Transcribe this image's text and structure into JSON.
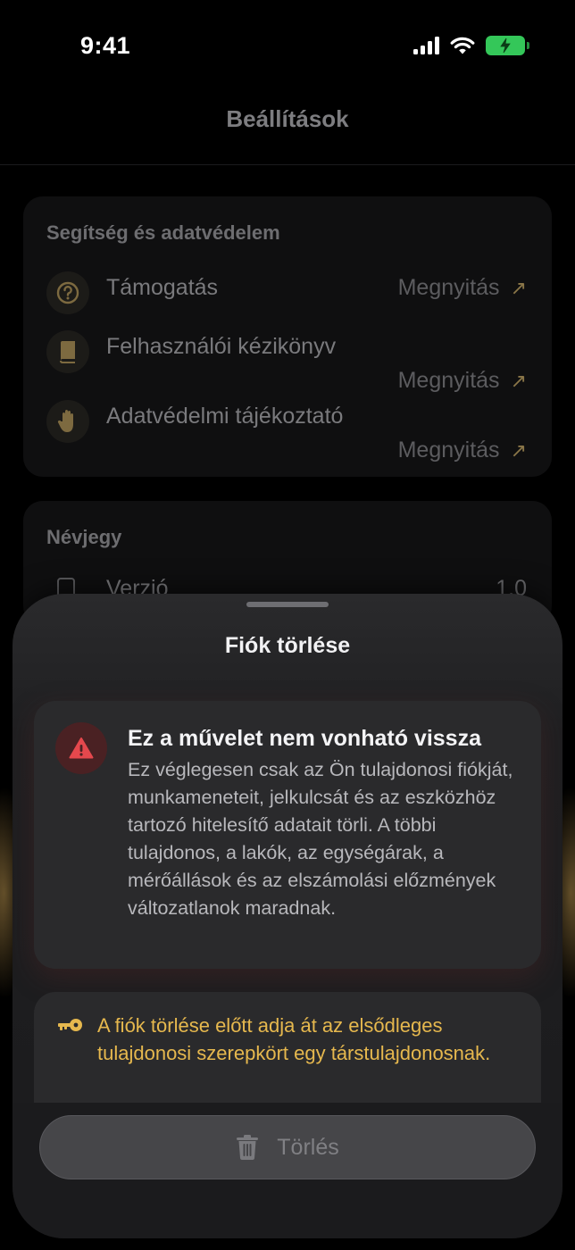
{
  "status_bar": {
    "time": "9:41"
  },
  "nav": {
    "title": "Beállítások"
  },
  "help_section": {
    "heading": "Segítség és adatvédelem",
    "items": [
      {
        "icon": "question-icon",
        "label": "Támogatás",
        "action": "Megnyitás"
      },
      {
        "icon": "book-icon",
        "label": "Felhasználói kézikönyv",
        "action": "Megnyitás"
      },
      {
        "icon": "hand-icon",
        "label": "Adatvédelmi tájékoztató",
        "action": "Megnyitás"
      }
    ]
  },
  "about_section": {
    "heading": "Névjegy",
    "items": [
      {
        "icon": "device-icon",
        "label": "Verzió",
        "value": "1.0"
      }
    ]
  },
  "sheet": {
    "title": "Fiók törlése",
    "warning": {
      "icon": "warning-triangle-icon",
      "title": "Ez a művelet nem vonható vissza",
      "body": "Ez véglegesen csak az Ön tulajdonosi fiókját, munkameneteit, jelkulcsát és az eszközhöz tartozó hitelesítő adatait törli. A többi tulajdonos, a lakók, az egységárak, a mérőállások és az elszámolási előzmények változatlanok maradnak."
    },
    "info": {
      "icon": "key-icon",
      "text": "A fiók törlése előtt adja át az elsődleges tulajdonosi szerepkört egy társtulajdonosnak."
    },
    "delete_button": {
      "icon": "trash-icon",
      "label": "Törlés"
    }
  },
  "colors": {
    "accent": "#e6b84e",
    "danger": "#e5484d",
    "battery": "#34c759",
    "sheet_bg": "#1b1b1d",
    "card_bg": "#2a2a2c"
  }
}
